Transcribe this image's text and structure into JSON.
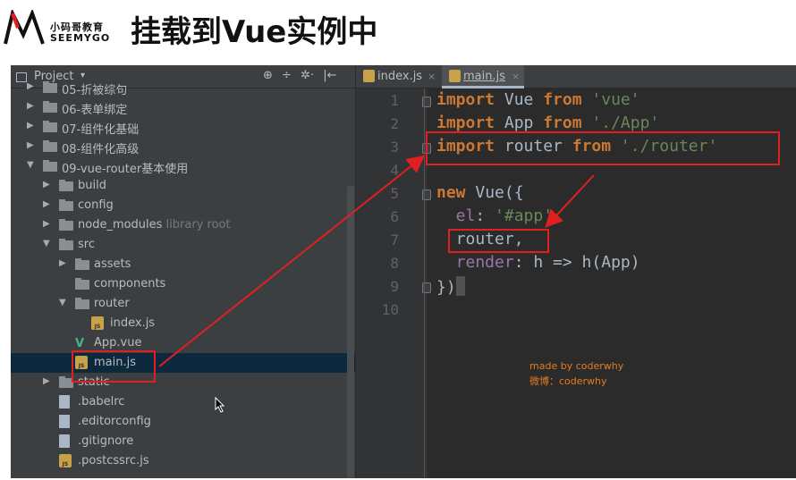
{
  "slide": {
    "logo_cn": "小码哥教育",
    "logo_en": "SEEMYGO",
    "title": "挂载到Vue实例中"
  },
  "project_panel": {
    "title": "Project",
    "caret": "▾",
    "tools": [
      "⊕",
      "÷",
      "✲·",
      "|←"
    ]
  },
  "tree": [
    {
      "label": "05-折被综句",
      "indent": 0,
      "type": "folder",
      "arrow": "▶"
    },
    {
      "label": "06-表单绑定",
      "indent": 0,
      "type": "folder",
      "arrow": "▶"
    },
    {
      "label": "07-组件化基础",
      "indent": 0,
      "type": "folder",
      "arrow": "▶"
    },
    {
      "label": "08-组件化高级",
      "indent": 0,
      "type": "folder",
      "arrow": "▶"
    },
    {
      "label": "09-vue-router基本使用",
      "indent": 0,
      "type": "folder",
      "arrow": "▼"
    },
    {
      "label": "build",
      "indent": 1,
      "type": "folder",
      "arrow": "▶"
    },
    {
      "label": "config",
      "indent": 1,
      "type": "folder",
      "arrow": "▶"
    },
    {
      "label": "node_modules",
      "hint": "library root",
      "indent": 1,
      "type": "folder",
      "arrow": "▶"
    },
    {
      "label": "src",
      "indent": 1,
      "type": "folder",
      "arrow": "▼"
    },
    {
      "label": "assets",
      "indent": 2,
      "type": "folder",
      "arrow": "▶"
    },
    {
      "label": "components",
      "indent": 2,
      "type": "folder",
      "arrow": ""
    },
    {
      "label": "router",
      "indent": 2,
      "type": "folder",
      "arrow": "▼"
    },
    {
      "label": "index.js",
      "indent": 3,
      "type": "js",
      "arrow": ""
    },
    {
      "label": "App.vue",
      "indent": 2,
      "type": "vue",
      "arrow": ""
    },
    {
      "label": "main.js",
      "indent": 2,
      "type": "js",
      "arrow": "",
      "selected": true
    },
    {
      "label": "static",
      "indent": 1,
      "type": "folder",
      "arrow": "▶"
    },
    {
      "label": ".babelrc",
      "indent": 1,
      "type": "file",
      "arrow": ""
    },
    {
      "label": ".editorconfig",
      "indent": 1,
      "type": "file",
      "arrow": ""
    },
    {
      "label": ".gitignore",
      "indent": 1,
      "type": "file",
      "arrow": ""
    },
    {
      "label": ".postcssrc.js",
      "indent": 1,
      "type": "js",
      "arrow": ""
    }
  ],
  "editor": {
    "tabs": [
      {
        "label": "index.js",
        "close": "×",
        "active": false
      },
      {
        "label": "main.js",
        "close": "×",
        "active": true
      }
    ],
    "line_numbers": [
      "1",
      "2",
      "3",
      "4",
      "5",
      "6",
      "7",
      "8",
      "9",
      "10"
    ],
    "lines": [
      [
        {
          "t": "import",
          "c": "kw"
        },
        {
          "t": " Vue ",
          "c": ""
        },
        {
          "t": "from",
          "c": "kw"
        },
        {
          "t": " 'vue'",
          "c": "str"
        }
      ],
      [
        {
          "t": "import",
          "c": "kw"
        },
        {
          "t": " App ",
          "c": ""
        },
        {
          "t": "from",
          "c": "kw"
        },
        {
          "t": " './App'",
          "c": "str"
        }
      ],
      [
        {
          "t": "import",
          "c": "kw"
        },
        {
          "t": " router ",
          "c": ""
        },
        {
          "t": "from",
          "c": "kw"
        },
        {
          "t": " './router'",
          "c": "str"
        }
      ],
      [],
      [
        {
          "t": "new",
          "c": "kw"
        },
        {
          "t": " Vue({",
          "c": ""
        }
      ],
      [
        {
          "t": "  el",
          "c": "prop"
        },
        {
          "t": ": ",
          "c": ""
        },
        {
          "t": "'#app'",
          "c": "str"
        },
        {
          "t": ",",
          "c": ""
        }
      ],
      [
        {
          "t": "  router,",
          "c": ""
        }
      ],
      [
        {
          "t": "  render",
          "c": "prop"
        },
        {
          "t": ": h => h(App)",
          "c": ""
        }
      ],
      [
        {
          "t": "})",
          "c": ""
        }
      ],
      []
    ]
  },
  "watermark": {
    "line1": "made by coderwhy",
    "line2": "微博：coderwhy"
  },
  "annotation_color": "#e02020"
}
